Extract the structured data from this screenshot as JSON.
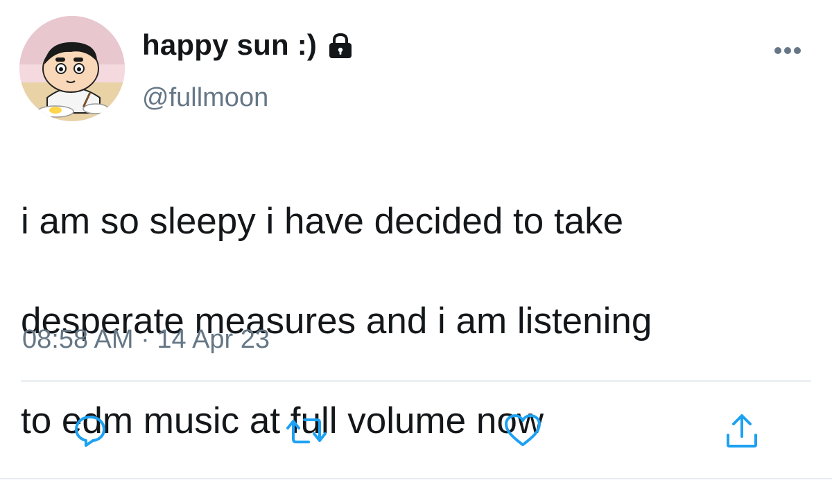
{
  "tweet": {
    "display_name": "happy sun :)",
    "handle": "@fullmoon",
    "protected_icon": "lock-icon",
    "avatar": "avatar-image",
    "text_lines": [
      "i am so sleepy i have decided to take",
      "desperate measures and i am listening",
      "to edm music at full volume now"
    ],
    "time": "08:58 AM",
    "separator": "·",
    "date": "14 Apr 23"
  },
  "actions": {
    "reply_icon": "reply-icon",
    "retweet_icon": "retweet-icon",
    "like_icon": "heart-icon",
    "share_icon": "share-icon",
    "more_icon": "more-icon"
  },
  "colors": {
    "text": "#14171a",
    "secondary": "#657786",
    "icon": "#1da1f2",
    "divider": "#e6ecf0"
  }
}
